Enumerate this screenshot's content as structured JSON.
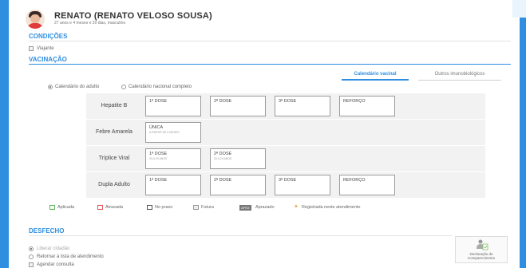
{
  "patient": {
    "name": "RENATO (RENATO VELOSO SOUSA)",
    "info": "27 anos e 4 meses e 20 dias, masculino"
  },
  "condicoes": {
    "title": "CONDIÇÕES",
    "viajante_label": "Viajante"
  },
  "vacinacao": {
    "title": "VACINAÇÃO",
    "tabs": [
      {
        "label": "Calendário vacinal",
        "active": true
      },
      {
        "label": "Outros imunobiológicos",
        "active": false
      }
    ],
    "calendar_options": [
      {
        "label": "Calendário do adulto",
        "selected": true
      },
      {
        "label": "Calendário nacional completo",
        "selected": false
      }
    ],
    "vaccines": [
      {
        "name": "Hepatite B",
        "doses": [
          {
            "label": "1ª DOSE",
            "sub": ""
          },
          {
            "label": "2ª DOSE",
            "sub": ""
          },
          {
            "label": "3ª DOSE",
            "sub": ""
          },
          {
            "label": "REFORÇO",
            "sub": ""
          }
        ]
      },
      {
        "name": "Febre Amarela",
        "doses": [
          {
            "label": "ÚNICA",
            "sub": "A PARTIR DE 9 MESES"
          }
        ]
      },
      {
        "name": "Tríplice Viral",
        "doses": [
          {
            "label": "1ª DOSE",
            "sub": "20 A 29 ANOS"
          },
          {
            "label": "2ª DOSE",
            "sub": "20 A 29 ANOS"
          }
        ]
      },
      {
        "name": "Dupla Adulto",
        "doses": [
          {
            "label": "1ª DOSE",
            "sub": ""
          },
          {
            "label": "2ª DOSE",
            "sub": ""
          },
          {
            "label": "3ª DOSE",
            "sub": ""
          },
          {
            "label": "REFORÇO",
            "sub": ""
          }
        ]
      }
    ],
    "legend": {
      "aplicada": "Aplicada",
      "atrasada": "Atrasada",
      "no_prazo": "No prazo",
      "futura": "Futura",
      "apraz_tag": "APRZ",
      "aprazado": "Aprazado",
      "registrada": "Registrada neste atendimento"
    }
  },
  "desfecho": {
    "title": "DESFECHO",
    "options": [
      {
        "label": "Liberar cidadão",
        "selected": true
      },
      {
        "label": "Retornar à lista de atendimento",
        "selected": false
      }
    ],
    "agendar_label": "Agendar consulta",
    "declaracao_line1": "Declaração de",
    "declaracao_line2": "Comparecimento"
  },
  "colors": {
    "accent": "#2f8ee0",
    "aplicada": "#5cb85c",
    "atrasada": "#e05656",
    "registrada": "#e8a13a"
  }
}
